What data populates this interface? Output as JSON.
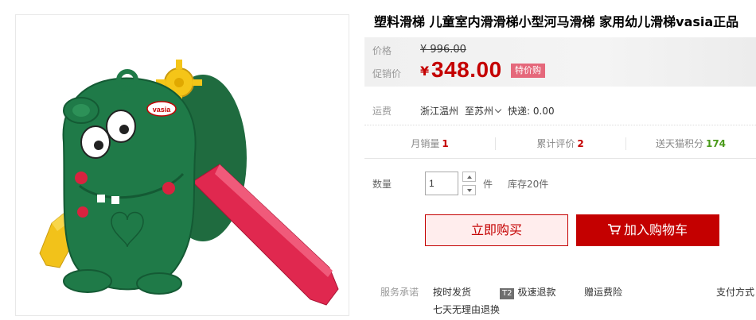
{
  "product": {
    "title": "塑料滑梯 儿童室内滑滑梯小型河马滑梯 家用幼儿滑梯vasia正品",
    "image_brand_text": "vasia"
  },
  "price": {
    "label": "价格",
    "original": "¥ 996.00",
    "promo_label": "促销价",
    "currency": "¥",
    "promo_value": "348.00",
    "promo_badge": "特价购"
  },
  "shipping": {
    "label": "运费",
    "from": "浙江温州",
    "to": "至苏州",
    "fee": "快递: 0.00"
  },
  "stats": [
    {
      "label": "月销量",
      "value": "1"
    },
    {
      "label": "累计评价",
      "value": "2"
    },
    {
      "label": "送天猫积分",
      "value": "174"
    }
  ],
  "quantity": {
    "label": "数量",
    "value": "1",
    "unit": "件",
    "stock": "库存20件"
  },
  "actions": {
    "buy_now": "立即购买",
    "add_cart": "加入购物车"
  },
  "services": {
    "label": "服务承诺",
    "items": [
      "按时发货",
      "极速退款",
      "赠运费险",
      "七天无理由退换"
    ],
    "t2_tag": "T2",
    "payment_label": "支付方式"
  },
  "colors": {
    "accent_red": "#c40000",
    "badge_pink": "#e5687b",
    "points_green": "#4a9a1a"
  }
}
